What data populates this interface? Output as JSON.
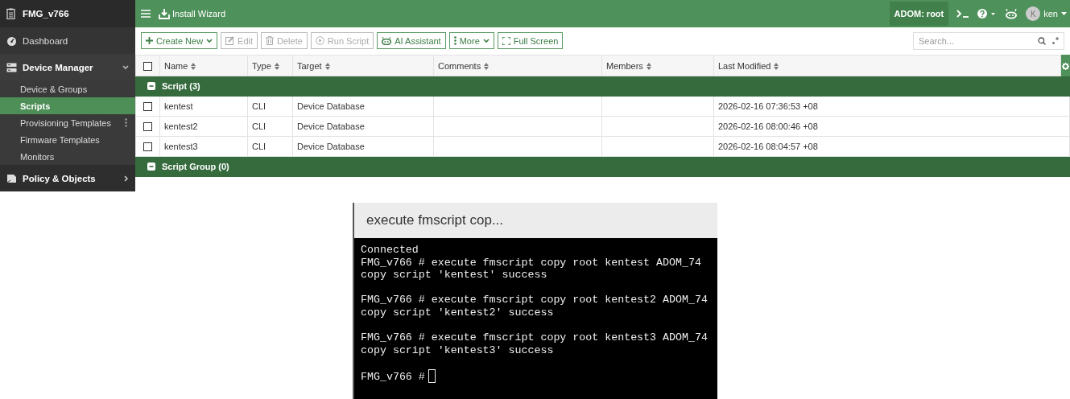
{
  "sidebar": {
    "title": "FMG_v766",
    "items": [
      {
        "kind": "link",
        "label": "Dashboard"
      },
      {
        "kind": "group",
        "label": "Device Manager",
        "expanded": true,
        "children": [
          {
            "label": "Device & Groups",
            "selected": false
          },
          {
            "label": "Scripts",
            "selected": true
          },
          {
            "label": "Provisioning Templates",
            "selected": false
          },
          {
            "label": "Firmware Templates",
            "selected": false
          },
          {
            "label": "Monitors",
            "selected": false
          }
        ]
      },
      {
        "kind": "group",
        "label": "Policy & Objects",
        "expanded": false
      }
    ]
  },
  "header": {
    "install_wizard": "Install Wizard",
    "adom": "ADOM: root",
    "user": {
      "initial": "K",
      "name": "ken"
    }
  },
  "toolbar": {
    "buttons": [
      {
        "kind": "create",
        "label": "Create New",
        "disabled": false,
        "dropdown": true
      },
      {
        "kind": "edit",
        "label": "Edit",
        "disabled": true,
        "dropdown": false
      },
      {
        "kind": "delete",
        "label": "Delete",
        "disabled": true,
        "dropdown": false
      },
      {
        "kind": "run",
        "label": "Run Script",
        "disabled": true,
        "dropdown": false
      },
      {
        "kind": "ai",
        "label": "AI Assistant",
        "disabled": false,
        "dropdown": false
      },
      {
        "kind": "more",
        "label": "More",
        "disabled": false,
        "dropdown": true
      },
      {
        "kind": "fullscreen",
        "label": "Full Screen",
        "disabled": false,
        "dropdown": false
      }
    ],
    "search": {
      "placeholder": "Search..."
    }
  },
  "table": {
    "all_checked": false,
    "columns": [
      "Name",
      "Type",
      "Target",
      "Comments",
      "Members",
      "Last Modified"
    ],
    "groups": [
      {
        "label": "Script (3)",
        "expanded": true,
        "rows": [
          {
            "checked": false,
            "cells": [
              "kentest",
              "CLI",
              "Device Database",
              "",
              "",
              "2026-02-16 07:36:53 +08"
            ]
          },
          {
            "checked": false,
            "cells": [
              "kentest2",
              "CLI",
              "Device Database",
              "",
              "",
              "2026-02-16 08:00:46 +08"
            ]
          },
          {
            "checked": false,
            "cells": [
              "kentest3",
              "CLI",
              "Device Database",
              "",
              "",
              "2026-02-16 08:04:57 +08"
            ]
          }
        ]
      },
      {
        "label": "Script Group (0)",
        "expanded": true
      }
    ]
  },
  "terminal": {
    "title": "execute fmscript cop...",
    "blocks": [
      [
        "Connected",
        "FMG_v766 # execute fmscript copy root kentest ADOM_74",
        "copy script 'kentest' success"
      ],
      [
        "FMG_v766 # execute fmscript copy root kentest2 ADOM_74",
        "copy script 'kentest2' success"
      ],
      [
        "FMG_v766 # execute fmscript copy root kentest3 ADOM_74",
        "copy script 'kentest3' success"
      ]
    ],
    "prompt": "FMG_v766 #"
  }
}
